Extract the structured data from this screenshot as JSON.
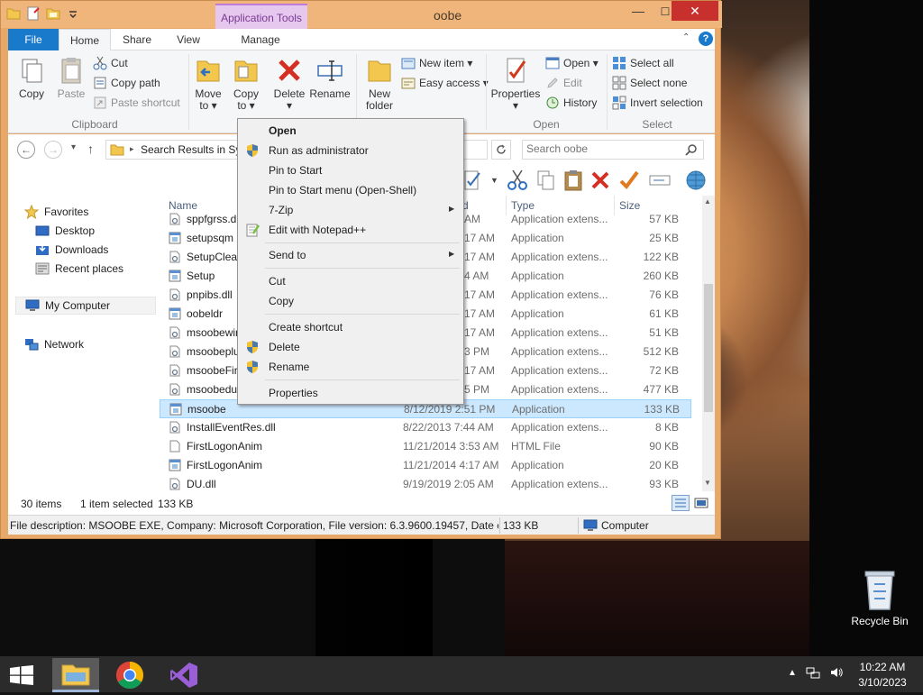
{
  "window": {
    "title": "oobe",
    "context_tab": "Application Tools",
    "minimize": "—",
    "maximize": "☐",
    "close": "✕"
  },
  "tabs": [
    "File",
    "Home",
    "Share",
    "View",
    "Manage"
  ],
  "help": "?",
  "ribbon": {
    "clipboard": {
      "copy": "Copy",
      "paste": "Paste",
      "cut": "Cut",
      "copy_path": "Copy path",
      "paste_shortcut": "Paste shortcut",
      "group": "Clipboard"
    },
    "organize": {
      "move_to": "Move to ▾",
      "copy_to": "Copy to ▾",
      "delete": "Delete ▾",
      "rename": "Rename"
    },
    "new": {
      "new_folder": "New folder",
      "new_item": "New item ▾",
      "easy_access": "Easy access ▾"
    },
    "open": {
      "properties": "Properties ▾",
      "open": "Open ▾",
      "edit": "Edit",
      "history": "History",
      "group": "Open"
    },
    "select": {
      "select_all": "Select all",
      "select_none": "Select none",
      "invert_selection": "Invert selection",
      "group": "Select"
    }
  },
  "address": {
    "path": "Search Results in Sys",
    "search_placeholder": "Search oobe"
  },
  "nav": {
    "favorites": "Favorites",
    "desktop": "Desktop",
    "downloads": "Downloads",
    "recent": "Recent places",
    "my_computer": "My Computer",
    "network": "Network"
  },
  "columns": {
    "name": "Name",
    "date": "d",
    "type": "Type",
    "size": "Size"
  },
  "files": [
    {
      "name": "sppfgrss.dll",
      "date": "AM",
      "type": "Application extens...",
      "size": "57 KB"
    },
    {
      "name": "setupsqm",
      "date": "17 AM",
      "type": "Application",
      "size": "25 KB"
    },
    {
      "name": "SetupCleanupTask",
      "date": "17 AM",
      "type": "Application extens...",
      "size": "122 KB"
    },
    {
      "name": "Setup",
      "date": "4 AM",
      "type": "Application",
      "size": "260 KB"
    },
    {
      "name": "pnpibs.dll",
      "date": "17 AM",
      "type": "Application extens...",
      "size": "76 KB"
    },
    {
      "name": "oobeldr",
      "date": "17 AM",
      "type": "Application",
      "size": "61 KB"
    },
    {
      "name": "msoobewirelessplugin.dll",
      "date": "17 AM",
      "type": "Application extens...",
      "size": "51 KB"
    },
    {
      "name": "msoobeplugins.dll",
      "date": "3 PM",
      "type": "Application extens...",
      "size": "512 KB"
    },
    {
      "name": "msoobeFirstLogonAnim.dll",
      "date": "17 AM",
      "type": "Application extens...",
      "size": "72 KB"
    },
    {
      "name": "msoobedui.dll",
      "date": "5 PM",
      "type": "Application extens...",
      "size": "477 KB"
    },
    {
      "name": "msoobe",
      "date": "8/12/2019 2:51 PM",
      "type": "Application",
      "size": "133 KB"
    },
    {
      "name": "InstallEventRes.dll",
      "date": "8/22/2013 7:44 AM",
      "type": "Application extens...",
      "size": "8 KB"
    },
    {
      "name": "FirstLogonAnim",
      "date": "11/21/2014 3:53 AM",
      "type": "HTML File",
      "size": "90 KB"
    },
    {
      "name": "FirstLogonAnim",
      "date": "11/21/2014 4:17 AM",
      "type": "Application",
      "size": "20 KB"
    },
    {
      "name": "DU.dll",
      "date": "9/19/2019 2:05 AM",
      "type": "Application extens...",
      "size": "93 KB"
    }
  ],
  "status": {
    "count": "30 items",
    "selected": "1 item selected",
    "size": "133 KB"
  },
  "description": {
    "text": "File description: MSOOBE EXE, Company: Microsoft Corporation, File version: 6.3.9600.19457, Date creat",
    "size": "133 KB",
    "location": "Computer"
  },
  "context_menu": {
    "open": "Open",
    "run_admin": "Run as administrator",
    "pin_start": "Pin to Start",
    "pin_start_menu": "Pin to Start menu (Open-Shell)",
    "zip": "7-Zip",
    "notepad": "Edit with Notepad++",
    "send_to": "Send to",
    "cut": "Cut",
    "copy": "Copy",
    "create_shortcut": "Create shortcut",
    "delete": "Delete",
    "rename": "Rename",
    "properties": "Properties"
  },
  "desktop": {
    "recycle_bin": "Recycle Bin"
  },
  "clock": {
    "time": "10:22 AM",
    "date": "3/10/2023"
  }
}
